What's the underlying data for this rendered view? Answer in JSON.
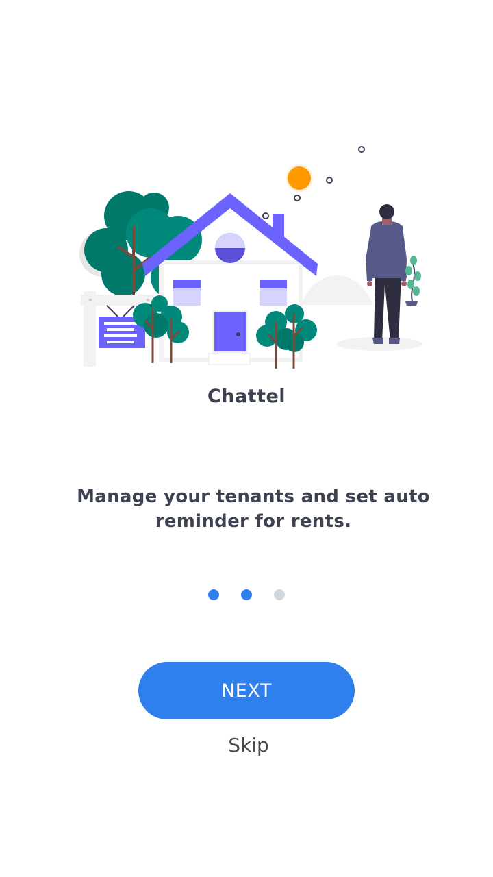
{
  "app": {
    "name": "Chattel",
    "tagline": "Manage your tenants and set auto reminder for rents."
  },
  "pagination": {
    "total": 3,
    "active": [
      true,
      true,
      false
    ]
  },
  "actions": {
    "next_label": "NEXT",
    "skip_label": "Skip"
  },
  "colors": {
    "accent": "#2f80ed",
    "text": "#3d4150",
    "illustration_purple": "#6c63ff",
    "tree_green": "#00897b",
    "sun_orange": "#ff9a00"
  }
}
